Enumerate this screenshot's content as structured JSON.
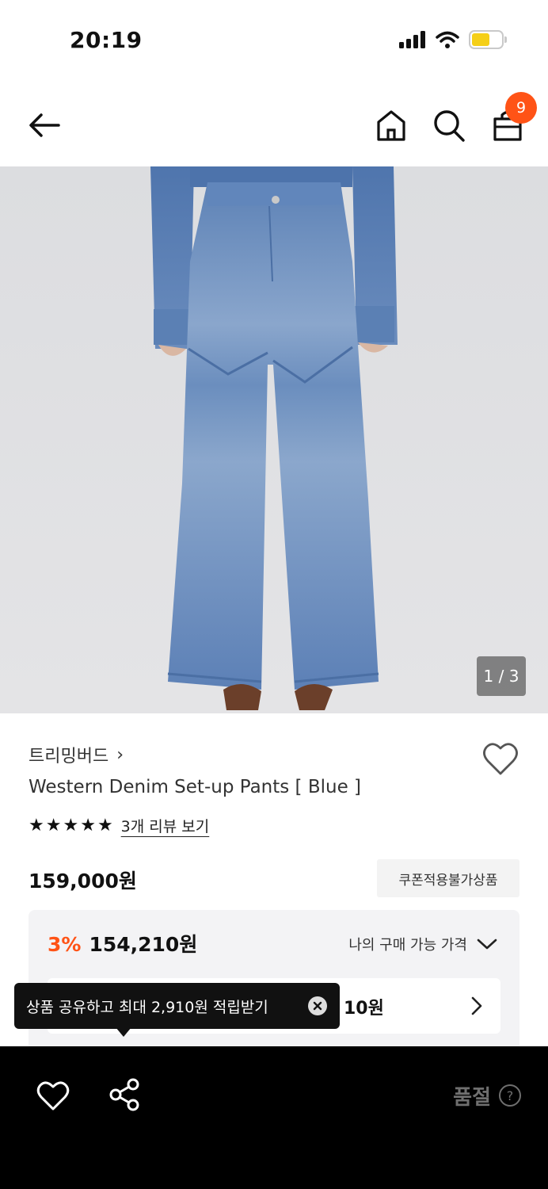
{
  "status_bar": {
    "time": "20:19"
  },
  "header": {
    "icons": [
      "back-arrow-icon",
      "home-icon",
      "search-icon",
      "shopping-bag-icon"
    ],
    "cart_count": "9",
    "badge_color": "#ff5316"
  },
  "gallery": {
    "counter": "1 / 3"
  },
  "product": {
    "brand": "트리밍버드",
    "brand_chevron": "›",
    "name": "Western Denim Set-up Pants [ Blue ]",
    "rating_stars": 5,
    "review_link": "3개 리뷰 보기",
    "price": "159,000원",
    "coupon_tag": "쿠폰적용불가상품"
  },
  "my_price": {
    "discount_percent": "3%",
    "discount_price": "154,210원",
    "toggle_label": "나의 구매 가능 가격",
    "inner_value_partial": "10원",
    "accent_color": "#ff5316"
  },
  "tooltip": {
    "text": "상품 공유하고 최대 2,910원 적립받기"
  },
  "bottom_bar": {
    "soldout_label": "품절",
    "help_label": "?"
  }
}
